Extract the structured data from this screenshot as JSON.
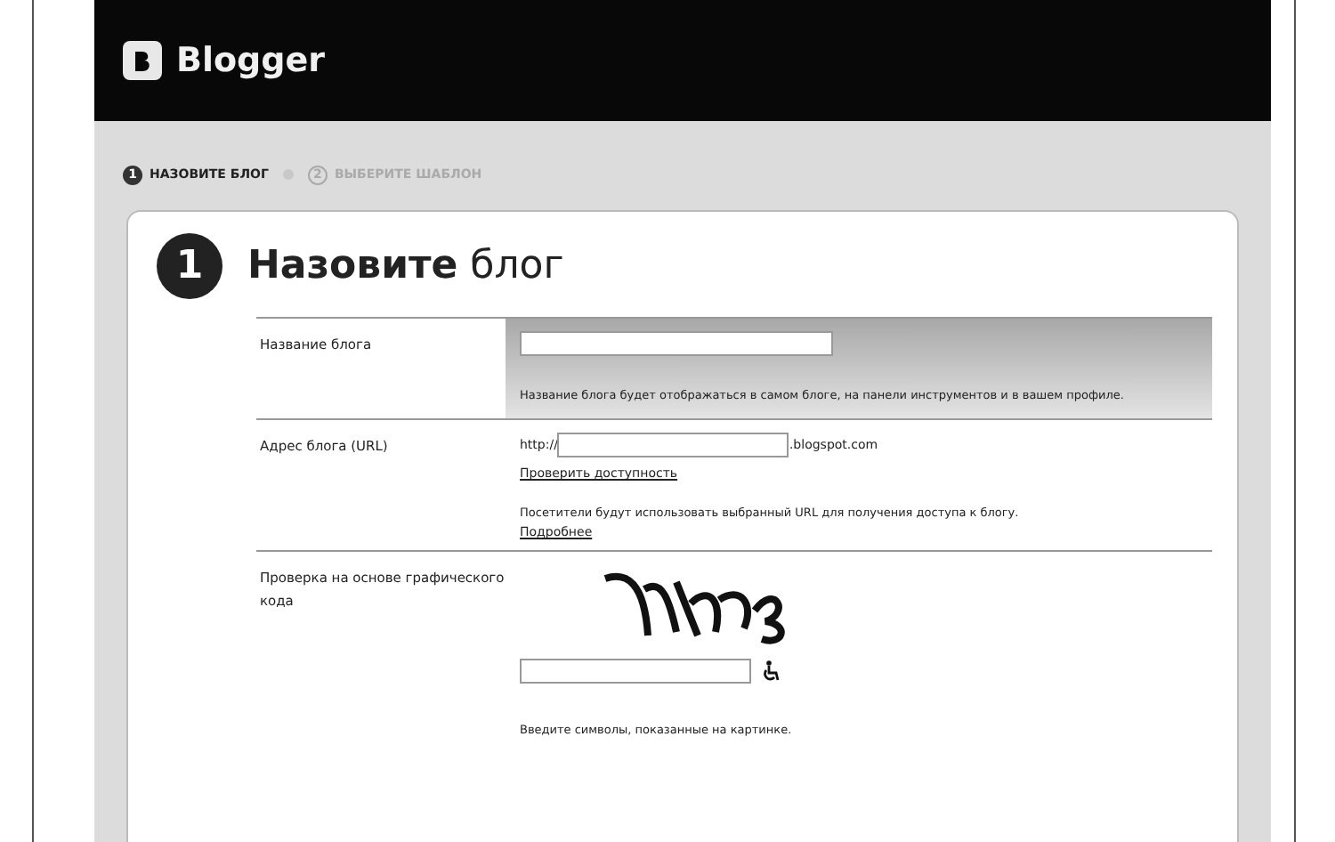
{
  "header": {
    "logo": "Blogger"
  },
  "steps": [
    {
      "number": "1",
      "label": "НАЗОВИТЕ БЛОГ",
      "selected": true
    },
    {
      "number": "2",
      "label": "ВЫБЕРИТЕ ШАБЛОН",
      "selected": false
    }
  ],
  "card": {
    "number": "1",
    "title_bold": "Назовите",
    "title_rest": "блог"
  },
  "rows": [
    {
      "kind": "title",
      "label": "Название блога",
      "hint": "Название блога будет отображаться в самом блоге, на панели инструментов и в вашем профиле."
    },
    {
      "kind": "url",
      "label": "Адрес блога (URL)",
      "prefix": "http://",
      "suffix": ".blogspot.com",
      "link": "Проверить доступность",
      "hint": "Посетители будут использовать выбранный URL для получения доступа к блогу.",
      "more": "Подробнее"
    },
    {
      "kind": "captcha",
      "label": "Проверка на основе графического кода",
      "hint": "Введите символы, показанные на картинке."
    }
  ]
}
